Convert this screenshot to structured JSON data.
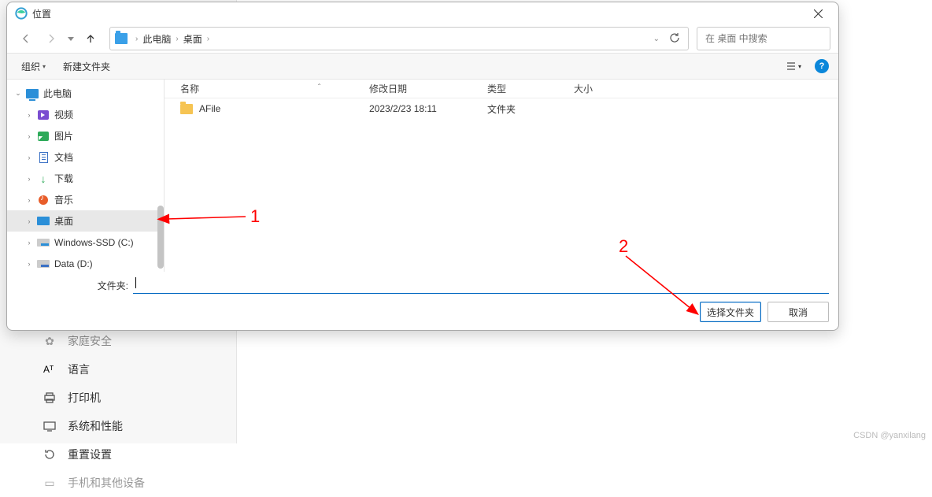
{
  "dialog": {
    "title": "位置",
    "breadcrumb": {
      "seg1": "此电脑",
      "seg2": "桌面"
    },
    "search_placeholder": "在 桌面 中搜索",
    "toolbar": {
      "organize": "组织",
      "new_folder": "新建文件夹"
    },
    "columns": {
      "name": "名称",
      "date": "修改日期",
      "type": "类型",
      "size": "大小"
    },
    "rows": [
      {
        "name": "AFile",
        "date": "2023/2/23 18:11",
        "type": "文件夹",
        "size": ""
      }
    ],
    "tree": {
      "this_pc": "此电脑",
      "video": "视频",
      "pictures": "图片",
      "documents": "文档",
      "downloads": "下载",
      "music": "音乐",
      "desktop": "桌面",
      "drive_c": "Windows-SSD (C:)",
      "drive_d": "Data (D:)"
    },
    "footer": {
      "folder_label": "文件夹:",
      "select_btn": "选择文件夹",
      "cancel_btn": "取消"
    }
  },
  "bg_settings": {
    "items": [
      {
        "label": "家庭安全"
      },
      {
        "label": "语言"
      },
      {
        "label": "打印机"
      },
      {
        "label": "系统和性能"
      },
      {
        "label": "重置设置"
      },
      {
        "label": "手机和其他设备"
      }
    ]
  },
  "annotations": {
    "one": "1",
    "two": "2"
  },
  "watermark": "CSDN @yanxilang"
}
